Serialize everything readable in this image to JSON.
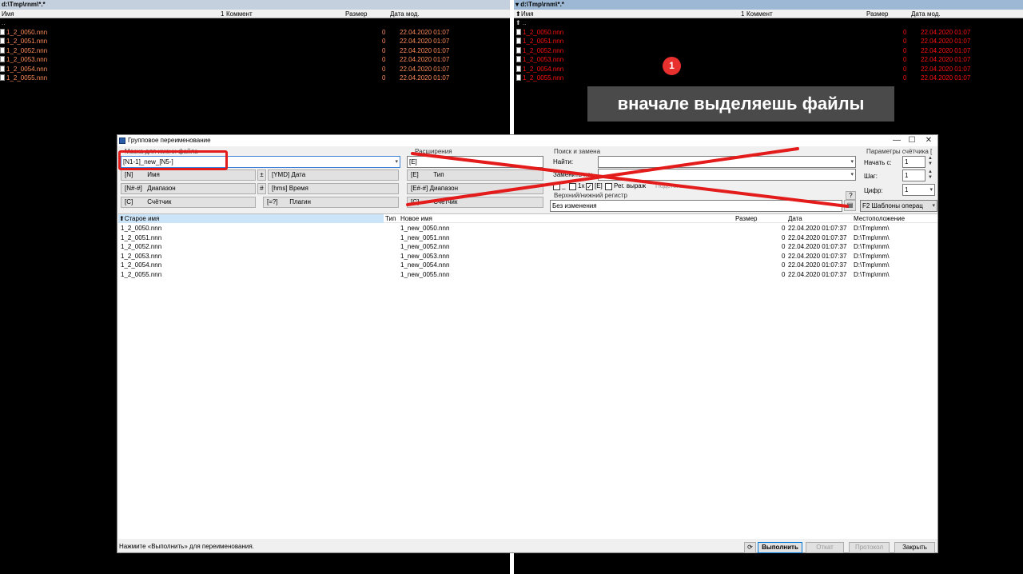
{
  "left_panel": {
    "path": "d:\\Tmp\\rnm\\*.*",
    "columns": {
      "name": "Имя",
      "comment": "Коммент",
      "comment_marker": "1",
      "size": "Размер",
      "date": "Дата мод."
    },
    "parent": "..",
    "files": [
      {
        "name": "1_2_0050.nnn",
        "size": "0",
        "date": "22.04.2020 01:07"
      },
      {
        "name": "1_2_0051.nnn",
        "size": "0",
        "date": "22.04.2020 01:07"
      },
      {
        "name": "1_2_0052.nnn",
        "size": "0",
        "date": "22.04.2020 01:07"
      },
      {
        "name": "1_2_0053.nnn",
        "size": "0",
        "date": "22.04.2020 01:07"
      },
      {
        "name": "1_2_0054.nnn",
        "size": "0",
        "date": "22.04.2020 01:07"
      },
      {
        "name": "1_2_0055.nnn",
        "size": "0",
        "date": "22.04.2020 01:07"
      }
    ]
  },
  "right_panel": {
    "path": "d:\\Tmp\\rnm\\*.*",
    "drive_marker": "▾",
    "columns": {
      "name": "Имя",
      "sort_marker": "⬆",
      "comment": "Коммент",
      "comment_marker": "1",
      "size": "Размер",
      "date": "Дата мод."
    },
    "parent": "..",
    "files": [
      {
        "name": "1_2_0050.nnn",
        "size": "0",
        "date": "22.04.2020 01:07"
      },
      {
        "name": "1_2_0051.nnn",
        "size": "0",
        "date": "22.04.2020 01:07"
      },
      {
        "name": "1_2_0052.nnn",
        "size": "0",
        "date": "22.04.2020 01:07"
      },
      {
        "name": "1_2_0053.nnn",
        "size": "0",
        "date": "22.04.2020 01:07"
      },
      {
        "name": "1_2_0054.nnn",
        "size": "0",
        "date": "22.04.2020 01:07"
      },
      {
        "name": "1_2_0055.nnn",
        "size": "0",
        "date": "22.04.2020 01:07"
      }
    ]
  },
  "annotation": {
    "step": "1",
    "text": "вначале выделяешь файлы"
  },
  "dialog": {
    "title": "Групповое переименование",
    "controls": {
      "minimize": "—",
      "maximize": "☐",
      "close": "✕"
    },
    "mask_group": {
      "title": "Маска для имени файла",
      "value": "[N1-1]_new_[N5-]",
      "buttons": [
        {
          "key": "[N]",
          "label": "Имя"
        },
        {
          "key": "[N#-#]",
          "label": "Диапазон"
        },
        {
          "key": "[C]",
          "label": "Счётчик"
        }
      ],
      "mini_buttons": [
        "±",
        "#",
        "[=?]"
      ],
      "mid_buttons": [
        {
          "key": "[YMD]",
          "label": "Дата"
        },
        {
          "key": "[hms]",
          "label": "Время"
        },
        {
          "key": "[=?]",
          "label": "Плагин"
        }
      ]
    },
    "ext_group": {
      "title": "Расширения",
      "value": "[E]",
      "buttons": [
        {
          "key": "[E]",
          "label": "Тип"
        },
        {
          "key": "[E#-#]",
          "label": "Диапазон"
        },
        {
          "key": "[C]",
          "label": "Счётчик"
        }
      ]
    },
    "search_group": {
      "title": "Поиск и замена",
      "find_label": "Найти:",
      "find_value": "",
      "replace_label": "Заменить на:",
      "replace_value": "",
      "opt_1x": "1x",
      "opt_e": "[E]",
      "opt_regex": "Рег. выраж",
      "opt_subst": "Подстан.",
      "case_title": "Верхний/нижний регистр",
      "case_value": "Без изменения",
      "help": "?"
    },
    "counter_group": {
      "title": "Параметры счётчика [",
      "start_label": "Начать с:",
      "start_value": "1",
      "step_label": "Шаг:",
      "step_value": "1",
      "digits_label": "Цифр:",
      "digits_value": "1",
      "templates": "F2 Шаблоны операц"
    },
    "results": {
      "columns": {
        "old": "Старое имя",
        "sort_marker": "⬆",
        "type": "Тип",
        "new": "Новое имя",
        "size": "Размер",
        "date": "Дата",
        "location": "Местоположение"
      },
      "rows": [
        {
          "old": "1_2_0050.nnn",
          "new": "1_new_0050.nnn",
          "size": "0",
          "date": "22.04.2020 01:07:37",
          "location": "D:\\Tmp\\rnm\\"
        },
        {
          "old": "1_2_0051.nnn",
          "new": "1_new_0051.nnn",
          "size": "0",
          "date": "22.04.2020 01:07:37",
          "location": "D:\\Tmp\\rnm\\"
        },
        {
          "old": "1_2_0052.nnn",
          "new": "1_new_0052.nnn",
          "size": "0",
          "date": "22.04.2020 01:07:37",
          "location": "D:\\Tmp\\rnm\\"
        },
        {
          "old": "1_2_0053.nnn",
          "new": "1_new_0053.nnn",
          "size": "0",
          "date": "22.04.2020 01:07:37",
          "location": "D:\\Tmp\\rnm\\"
        },
        {
          "old": "1_2_0054.nnn",
          "new": "1_new_0054.nnn",
          "size": "0",
          "date": "22.04.2020 01:07:37",
          "location": "D:\\Tmp\\rnm\\"
        },
        {
          "old": "1_2_0055.nnn",
          "new": "1_new_0055.nnn",
          "size": "0",
          "date": "22.04.2020 01:07:37",
          "location": "D:\\Tmp\\rnm\\"
        }
      ]
    },
    "status_text": "Нажмите «Выполнить» для переименования.",
    "buttons": {
      "reload": "⟳",
      "run": "Выполнить",
      "undo": "Откат",
      "log": "Протокол",
      "close": "Закрыть"
    }
  },
  "colors": {
    "accent_red": "#e41b1b",
    "left_file_color": "#ff8c5a",
    "right_file_color": "#ff1010"
  }
}
